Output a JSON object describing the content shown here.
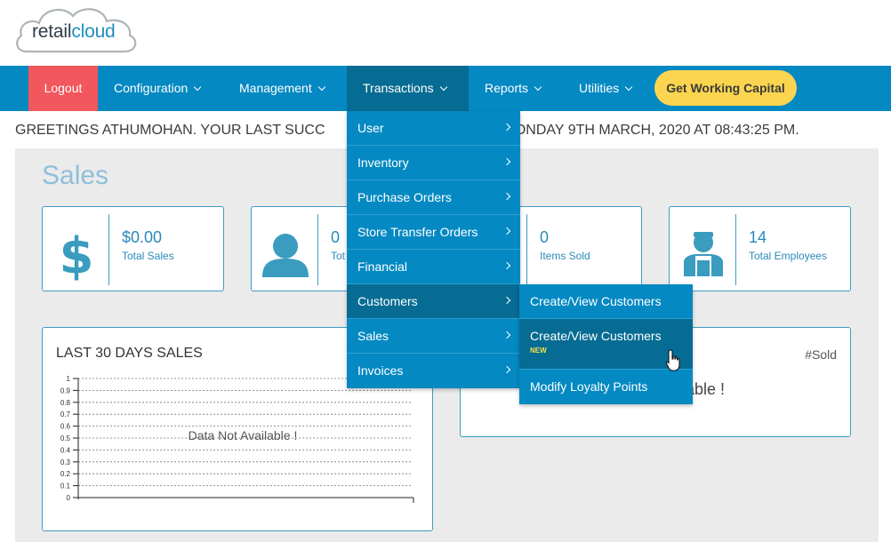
{
  "brand": {
    "logo_part1": "retail",
    "logo_part2": "cloud"
  },
  "nav": {
    "logout": "Logout",
    "configuration": "Configuration",
    "management": "Management",
    "transactions": "Transactions",
    "reports": "Reports",
    "utilities": "Utilities",
    "cta": "Get Working Capital"
  },
  "greeting": "GREETINGS ATHUMOHAN. YOUR LAST SUCCESSFUL LOGIN WAS ON MONDAY 9TH MARCH, 2020 AT 08:43:25 PM.",
  "greeting_visible_left": "GREETINGS ATHUMOHAN. YOUR LAST SUCC",
  "greeting_visible_right": "MONDAY 9TH MARCH, 2020 AT 08:43:25 PM.",
  "sales": {
    "title": "Sales",
    "stats": [
      {
        "value": "$0.00",
        "label": "Total Sales",
        "icon": "dollar-icon"
      },
      {
        "value": "0",
        "label": "Tot",
        "icon": "customer-icon"
      },
      {
        "value": "0",
        "label": "Items Sold",
        "icon": "box-icon"
      },
      {
        "value": "14",
        "label": "Total Employees",
        "icon": "employee-icon"
      }
    ]
  },
  "chart_left": {
    "title": "LAST 30 DAYS SALES",
    "empty_text": "Data Not Available !",
    "yticks": [
      "1",
      "0.9",
      "0.8",
      "0.7",
      "0.6",
      "0.5",
      "0.4",
      "0.3",
      "0.2",
      "0.1",
      "0"
    ]
  },
  "chart_right": {
    "sold_label": "#Sold",
    "empty_text_visible": "able !"
  },
  "transactions_menu": [
    {
      "label": "User"
    },
    {
      "label": "Inventory"
    },
    {
      "label": "Purchase Orders"
    },
    {
      "label": "Store Transfer Orders"
    },
    {
      "label": "Financial"
    },
    {
      "label": "Customers"
    },
    {
      "label": "Sales"
    },
    {
      "label": "Invoices"
    }
  ],
  "customers_submenu": [
    {
      "label": "Create/View Customers"
    },
    {
      "label": "Create/View Customers",
      "badge": "NEW"
    },
    {
      "label": "Modify Loyalty Points"
    }
  ],
  "colors": {
    "nav": "#0489c2",
    "nav_active": "#066c93",
    "logout": "#f1575c",
    "cta": "#fbd54f",
    "accent": "#3d9cc7"
  }
}
